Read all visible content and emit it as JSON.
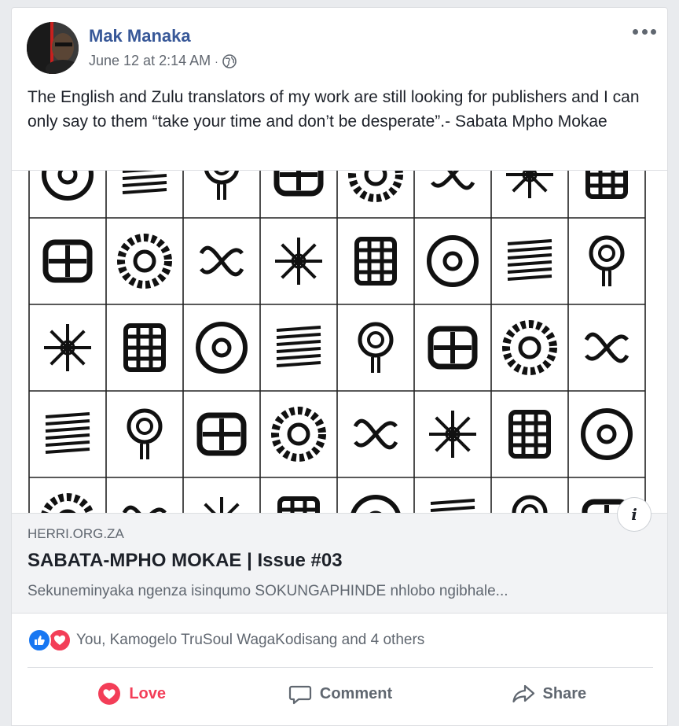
{
  "post": {
    "author": "Mak Manaka",
    "timestamp": "June 12 at 2:14 AM",
    "separator": "·",
    "privacy_icon": "globe-icon",
    "text": "The English and Zulu translators of my work are still looking for publishers and I can only say to them “take your time and don’t be desperate”.- Sabata Mpho Mokae"
  },
  "link_preview": {
    "domain": "HERRI.ORG.ZA",
    "title": "SABATA-MPHO MOKAE | Issue #03",
    "description": "Sekuneminyaka ngenza isinqumo SOKUNGAPHINDE nhlobo ngibhale...",
    "info_label": "i"
  },
  "reactions": {
    "icons": [
      "like-icon",
      "love-icon"
    ],
    "summary": "You, Kamogelo TruSoul WagaKodisang and 4 others"
  },
  "actions": {
    "love": "Love",
    "comment": "Comment",
    "share": "Share"
  },
  "colors": {
    "author": "#385898",
    "love": "#f33e58",
    "like": "#1877f2",
    "muted": "#606770"
  }
}
